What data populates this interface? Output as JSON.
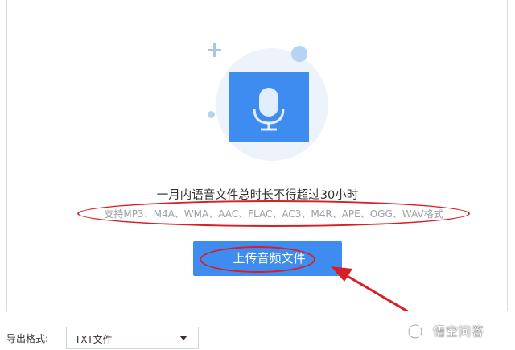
{
  "upload_area": {
    "limit_text": "一月内语音文件总时长不得超过30小时",
    "supported_formats": "支持MP3、M4A、WMA、AAC、FLAC、AC3、M4R、APE、OGG、WAV格式",
    "upload_button_label": "上传音频文件",
    "icon": "microphone-icon"
  },
  "export": {
    "label": "导出格式:",
    "selected_format": "TXT文件"
  },
  "watermark": {
    "text": "悟空问答",
    "logo": "wukong-logo"
  },
  "colors": {
    "accent": "#3f8cf0",
    "annotation_red": "#d61f26",
    "muted_text": "#9aa0a8",
    "circle_bg": "#edf3fb"
  }
}
